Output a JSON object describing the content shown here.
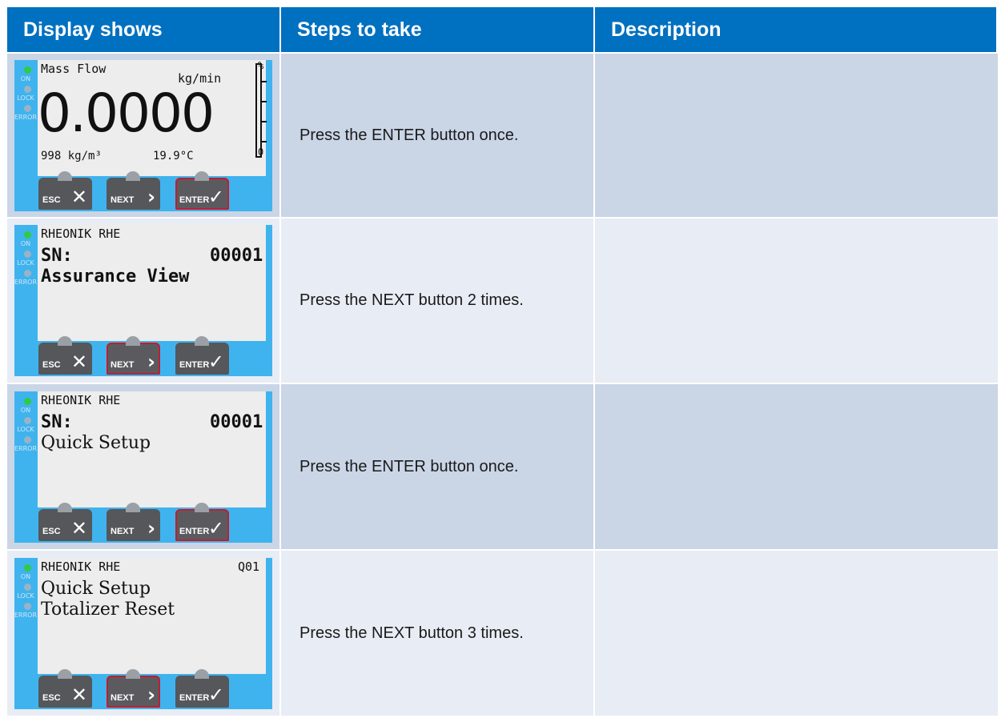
{
  "headers": [
    "Display shows",
    "Steps to take",
    "Description"
  ],
  "leds": {
    "on": "ON",
    "lock": "LOCK",
    "error": "ERROR"
  },
  "buttons": {
    "esc": "ESC",
    "next": "NEXT",
    "enter": "ENTER"
  },
  "rows": [
    {
      "active_button": "enter",
      "display": {
        "title": "Mass Flow",
        "unit": "kg/min",
        "value": "0.0000",
        "density": "998 kg/m³",
        "temperature": "19.9°C",
        "bar_top": "%",
        "bar_bottom": "0"
      },
      "step": "Press the ENTER button once.",
      "description": ""
    },
    {
      "active_button": "next",
      "display": {
        "line1": "RHEONIK RHE",
        "line1_right": "",
        "line2_left": "SN:",
        "line2_right": "00001",
        "line3": "Assurance View"
      },
      "step": "Press the NEXT button 2 times.",
      "description": ""
    },
    {
      "active_button": "enter",
      "display": {
        "line1": "RHEONIK RHE",
        "line1_right": "",
        "line2_left": "SN:",
        "line2_right": "00001",
        "line3": "Quick Setup"
      },
      "step": "Press the ENTER button once.",
      "description": ""
    },
    {
      "active_button": "next",
      "display": {
        "line1": "RHEONIK RHE",
        "line1_right": "Q01",
        "line2_left": "Quick Setup",
        "line2_right": "",
        "line3": "Totalizer Reset"
      },
      "step": "Press the NEXT button 3 times.",
      "description": ""
    }
  ]
}
